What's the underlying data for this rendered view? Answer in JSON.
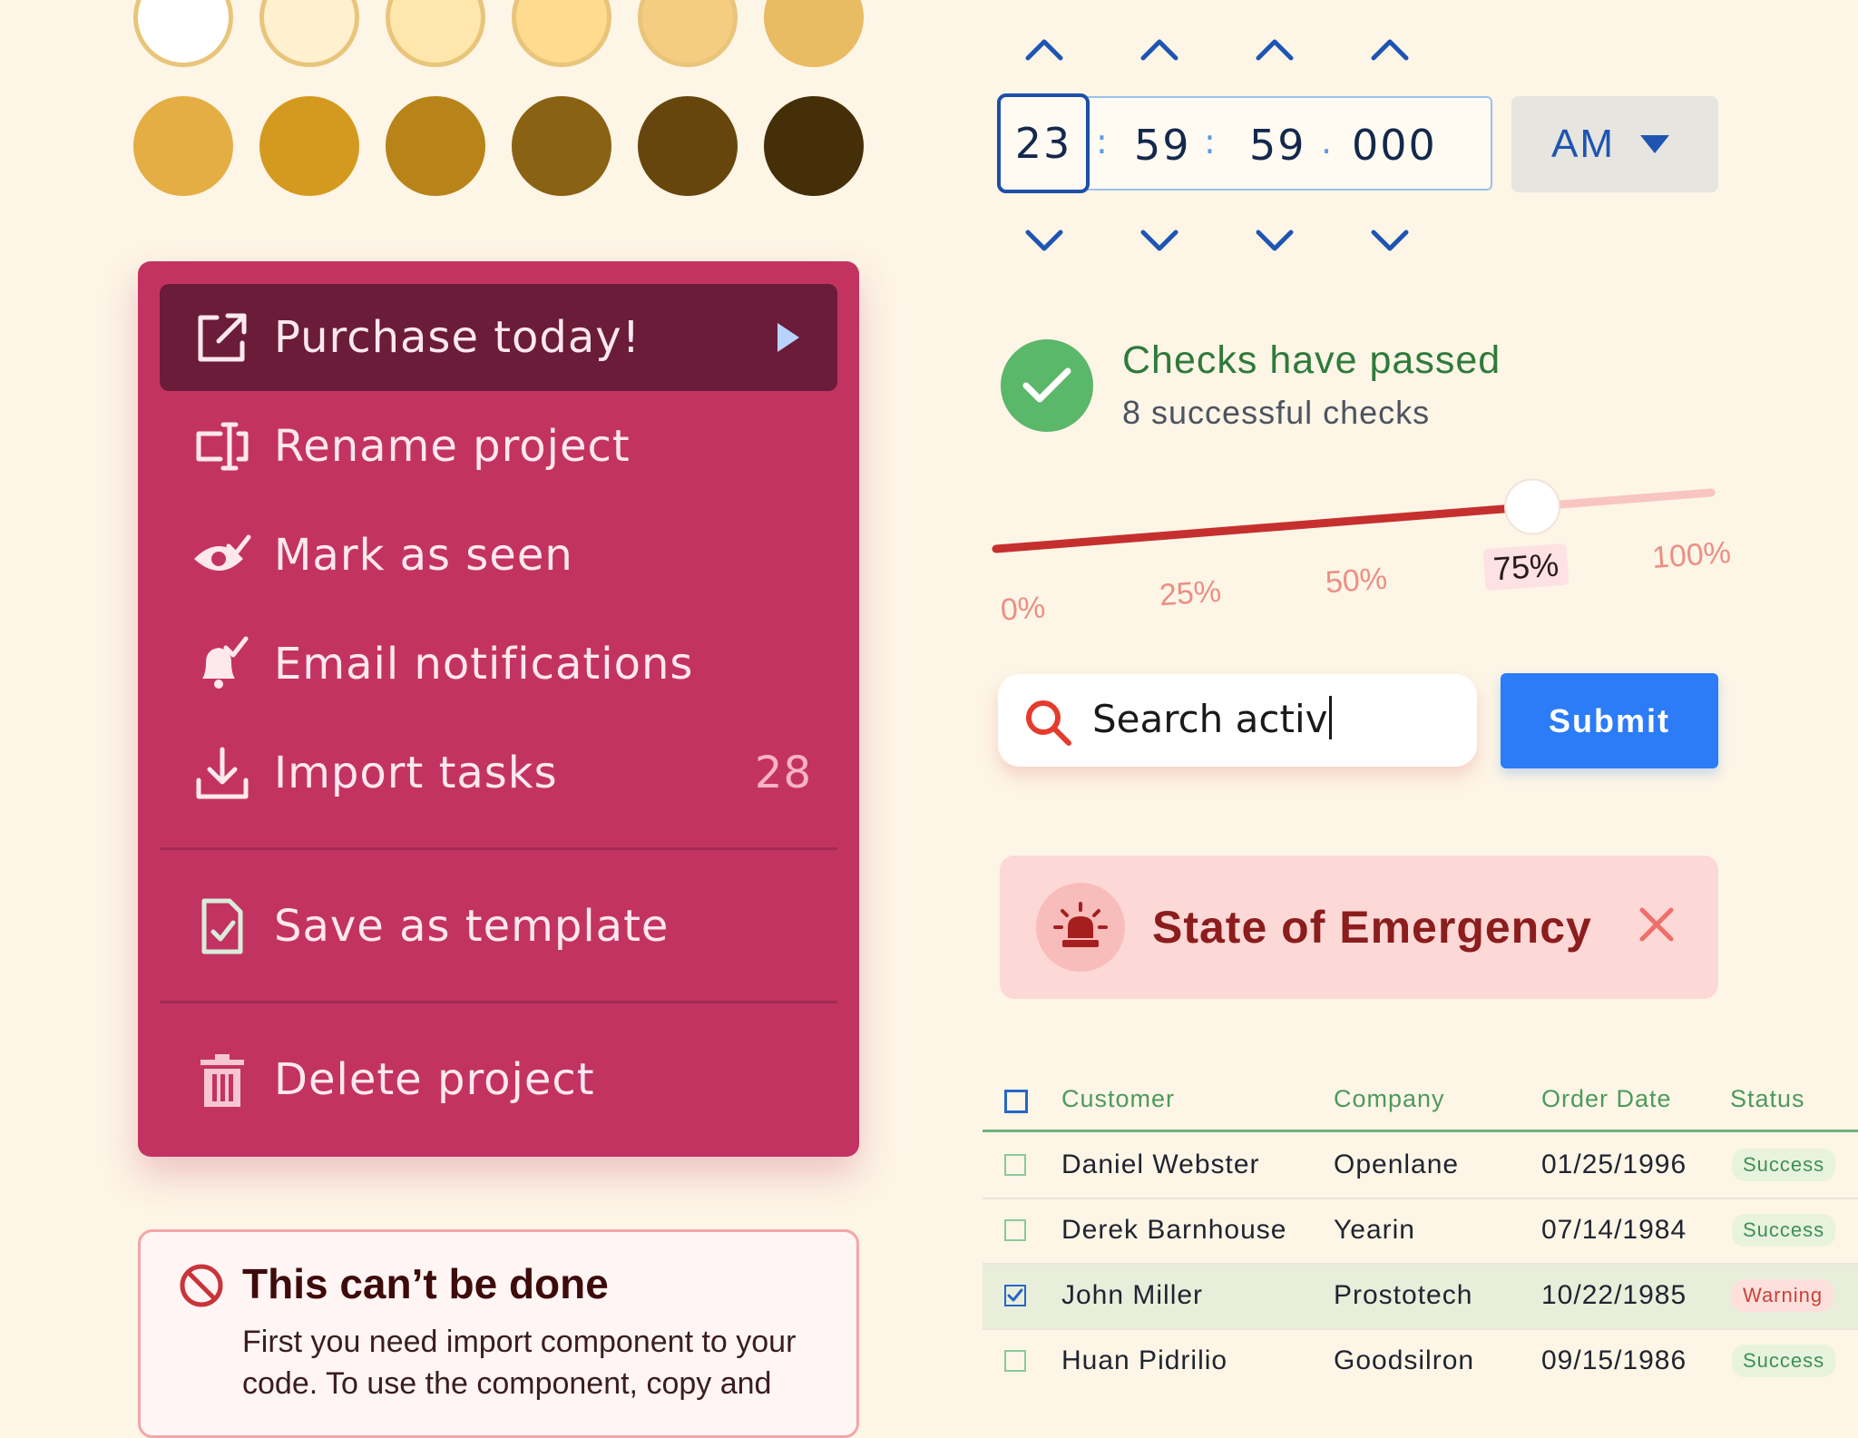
{
  "swatches": {
    "row1": [
      "#ffffff",
      "#fff0cf",
      "#ffe6ad",
      "#ffdb8f",
      "#f5cd80",
      "#e9bb62"
    ],
    "row2": [
      "#e4ae45",
      "#d49a1f",
      "#b88419",
      "#8a6213",
      "#67460e",
      "#452f08"
    ]
  },
  "menu": {
    "items": [
      {
        "label": "Purchase today!",
        "icon": "external-link-icon"
      },
      {
        "label": "Rename project",
        "icon": "text-cursor-icon"
      },
      {
        "label": "Mark as seen",
        "icon": "eye-check-icon"
      },
      {
        "label": "Email notifications",
        "icon": "bell-check-icon"
      },
      {
        "label": "Import tasks",
        "icon": "download-icon",
        "count": "28"
      },
      {
        "label": "Save as template",
        "icon": "file-check-icon"
      },
      {
        "label": "Delete project",
        "icon": "trash-icon"
      }
    ]
  },
  "error": {
    "title": "This can’t be done",
    "body": "First you need import component to your code. To use the component, copy and"
  },
  "time_picker": {
    "hours": "23",
    "minutes": "59",
    "seconds": "59",
    "milliseconds": "000",
    "sep1": ":",
    "sep2": ":",
    "sep3": ".",
    "period": "AM"
  },
  "checks": {
    "title": "Checks have passed",
    "subtitle": "8 successful checks"
  },
  "slider": {
    "value_fraction": 0.75,
    "labels": [
      "0%",
      "25%",
      "50%",
      "75%",
      "100%"
    ]
  },
  "search": {
    "value": "Search activ",
    "submit_label": "Submit"
  },
  "alert": {
    "title": "State of Emergency"
  },
  "table": {
    "headers": [
      "Customer",
      "Company",
      "Order Date",
      "Status"
    ],
    "rows": [
      {
        "customer": "Daniel Webster",
        "company": "Openlane",
        "date": "01/25/1996",
        "status": "Success",
        "checked": false
      },
      {
        "customer": "Derek Barnhouse",
        "company": "Yearin",
        "date": "07/14/1984",
        "status": "Success",
        "checked": false
      },
      {
        "customer": "John Miller",
        "company": "Prostotech",
        "date": "10/22/1985",
        "status": "Warning",
        "checked": true
      },
      {
        "customer": "Huan Pidrilio",
        "company": "Goodsilron",
        "date": "09/15/1986",
        "status": "Success",
        "checked": false
      }
    ]
  },
  "colors": {
    "background": "#fdf5e6",
    "menu": "#c33362",
    "menu_active": "#6b1c39",
    "accent_blue": "#2b7cf6",
    "success_green": "#5bb76a",
    "danger": "#8b1d1d"
  }
}
